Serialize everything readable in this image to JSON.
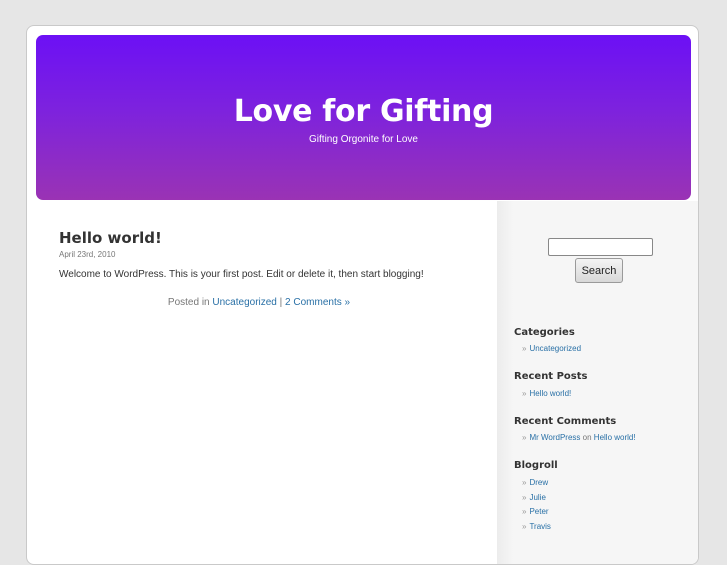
{
  "header": {
    "title": "Love for Gifting",
    "description": "Gifting Orgonite for Love"
  },
  "post": {
    "title": "Hello world!",
    "date": "April 23rd, 2010",
    "body": "Welcome to WordPress. This is your first post. Edit or delete it, then start blogging!",
    "meta_prefix": "Posted in",
    "category": "Uncategorized",
    "separator": "|",
    "comments": "2 Comments »"
  },
  "sidebar": {
    "search_value": "",
    "search_button": "Search",
    "bullet": "»",
    "categories": {
      "title": "Categories",
      "items": [
        "Uncategorized"
      ]
    },
    "recent_posts": {
      "title": "Recent Posts",
      "items": [
        "Hello world!"
      ]
    },
    "recent_comments": {
      "title": "Recent Comments",
      "author": "Mr WordPress",
      "on": "on",
      "post": "Hello world!"
    },
    "blogroll": {
      "title": "Blogroll",
      "items": [
        "Drew",
        "Julie",
        "Peter",
        "Travis"
      ]
    }
  },
  "colors": {
    "header_top": "#6c10f5",
    "header_bottom": "#9a33b4",
    "link": "#2970a6",
    "background": "#e6e6e6"
  }
}
